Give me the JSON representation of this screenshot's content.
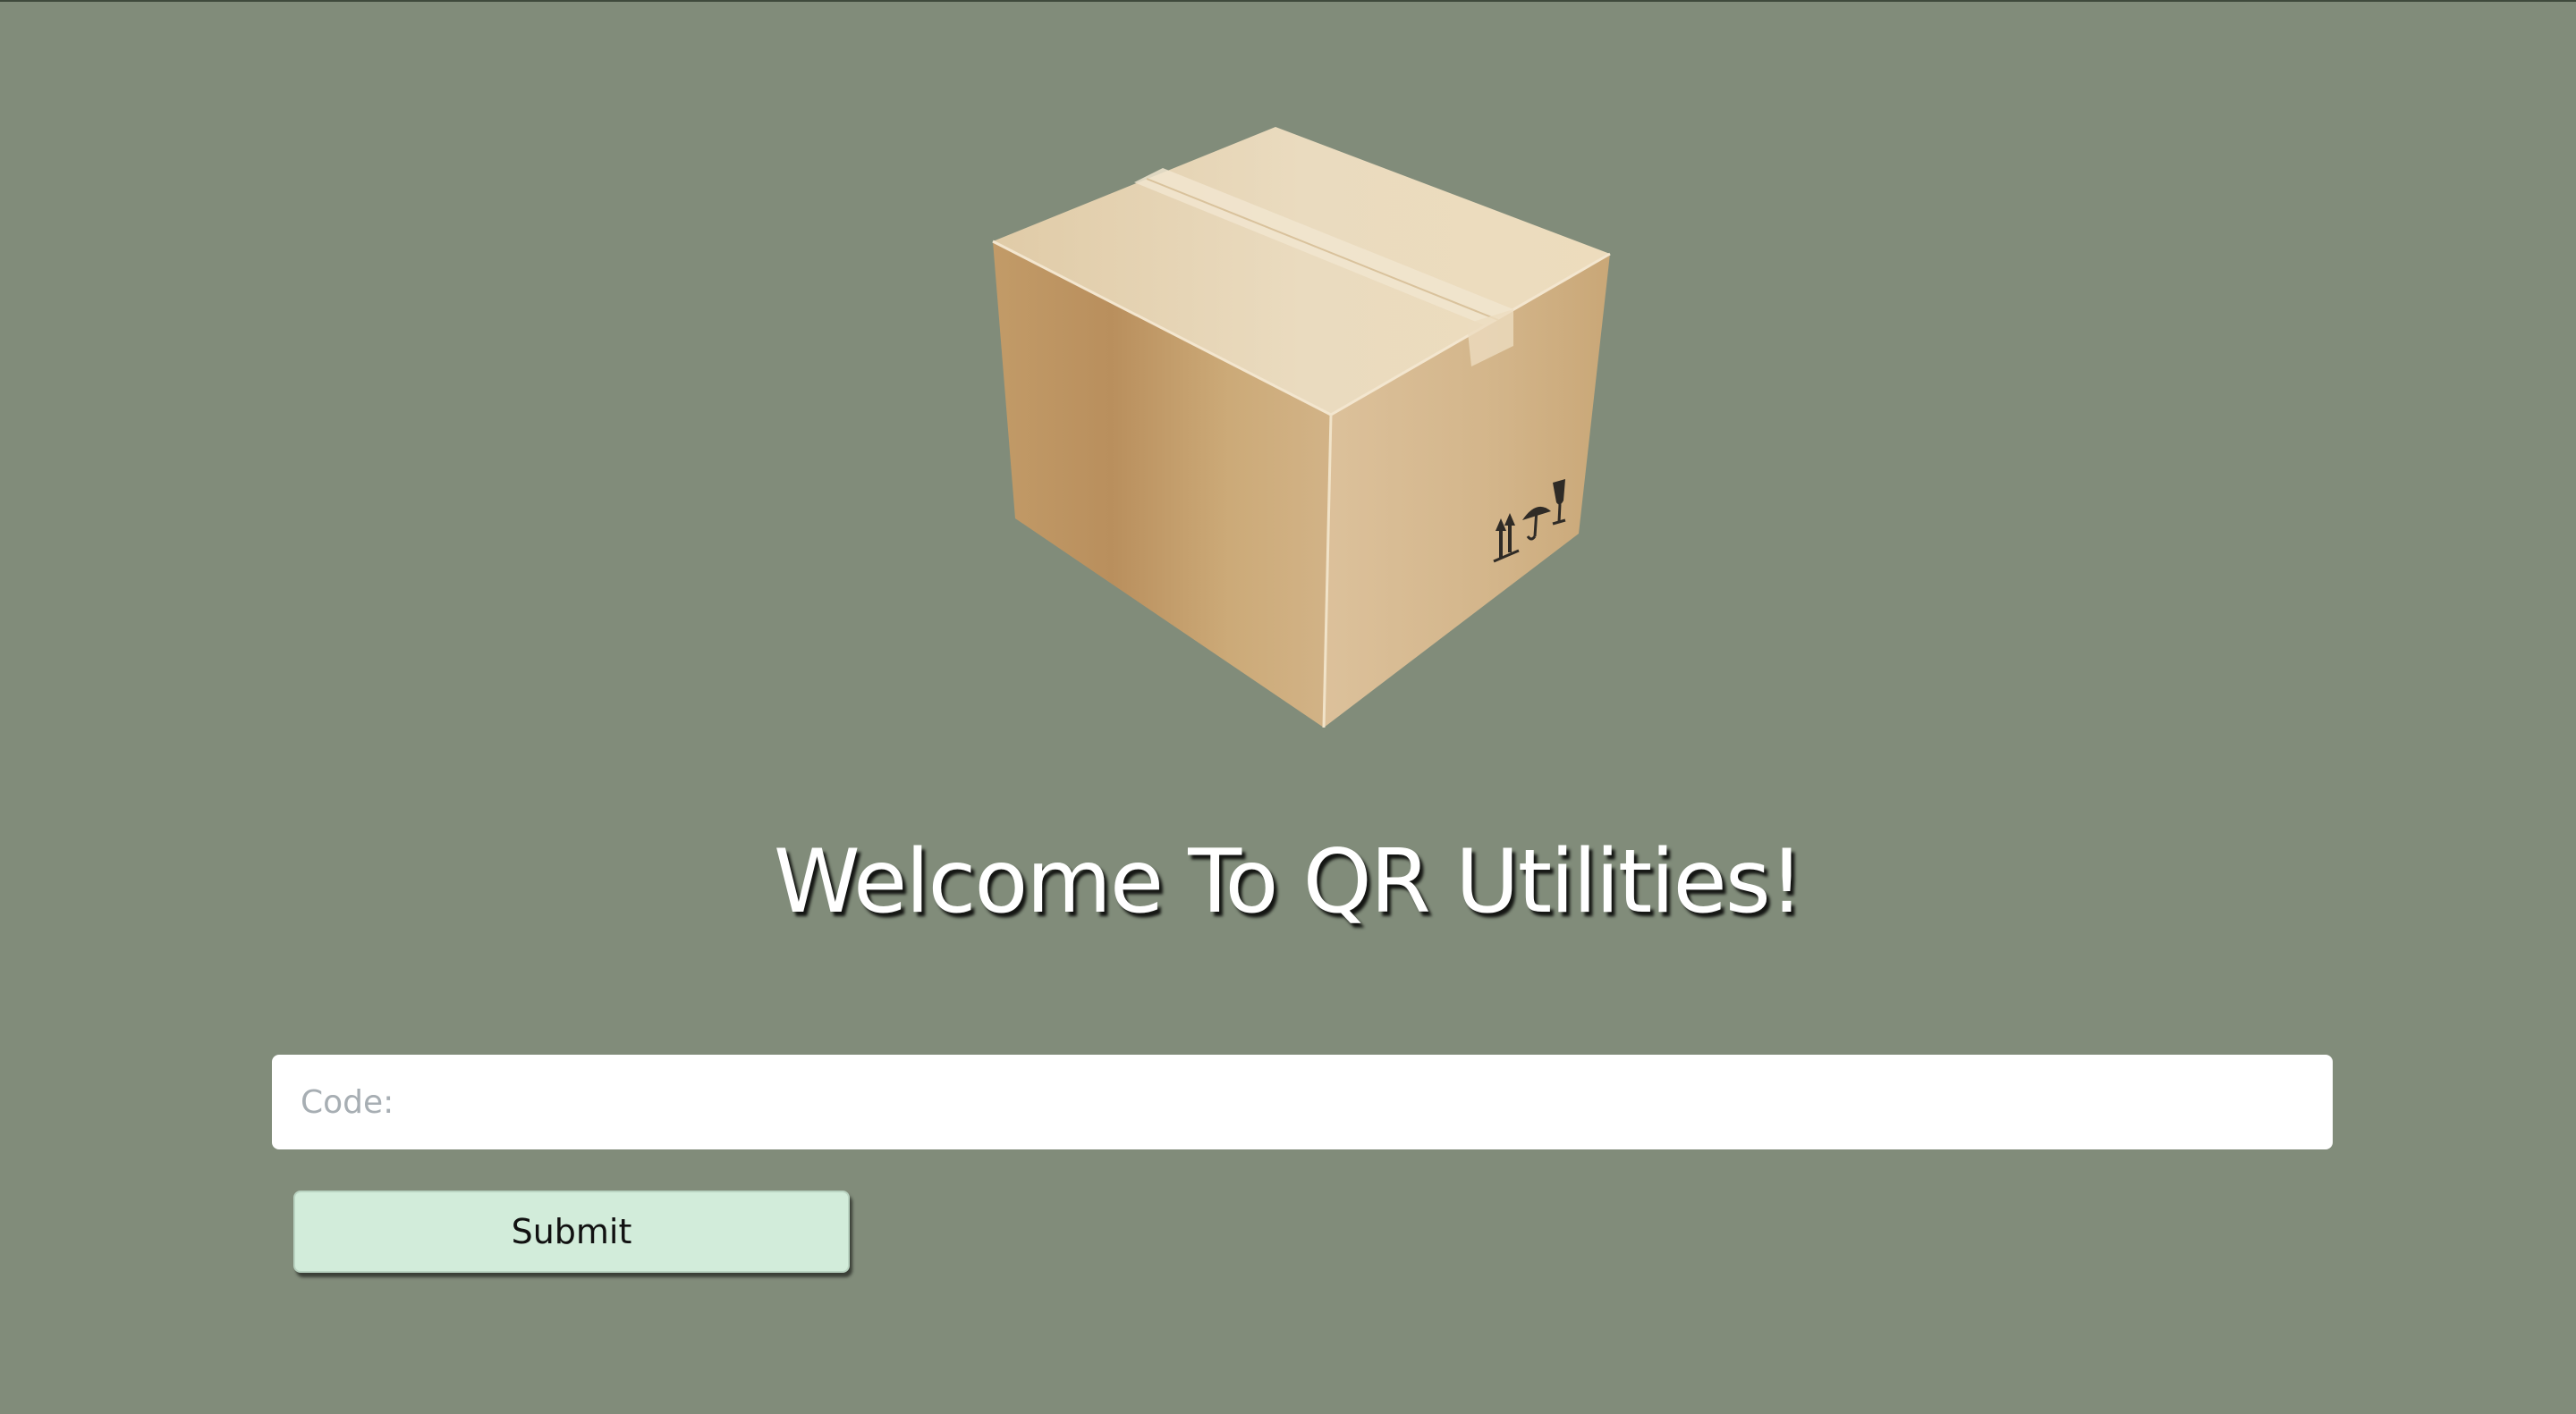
{
  "hero": {
    "image": "cardboard-box",
    "title": "Welcome To QR Utilities!"
  },
  "form": {
    "code_placeholder": "Code:",
    "code_value": "",
    "submit_label": "Submit"
  },
  "colors": {
    "background": "#818c7a",
    "input_background": "#ffffff",
    "button_background": "#d2ecda",
    "title_color": "#ffffff"
  }
}
